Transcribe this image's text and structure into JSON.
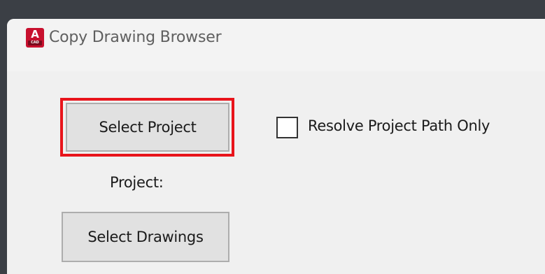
{
  "window": {
    "title": "Copy Drawing Browser",
    "icon": {
      "name": "autocad-icon",
      "letter": "A",
      "sub_label": "CAD",
      "color": "#c8102e"
    }
  },
  "buttons": {
    "select_project_label": "Select Project",
    "select_drawings_label": "Select Drawings"
  },
  "labels": {
    "project_label": "Project:"
  },
  "options": {
    "resolve_project_path_only": {
      "label": "Resolve Project Path Only",
      "checked": false
    }
  },
  "highlight": {
    "target": "select-project-button",
    "color": "#e8141b"
  }
}
